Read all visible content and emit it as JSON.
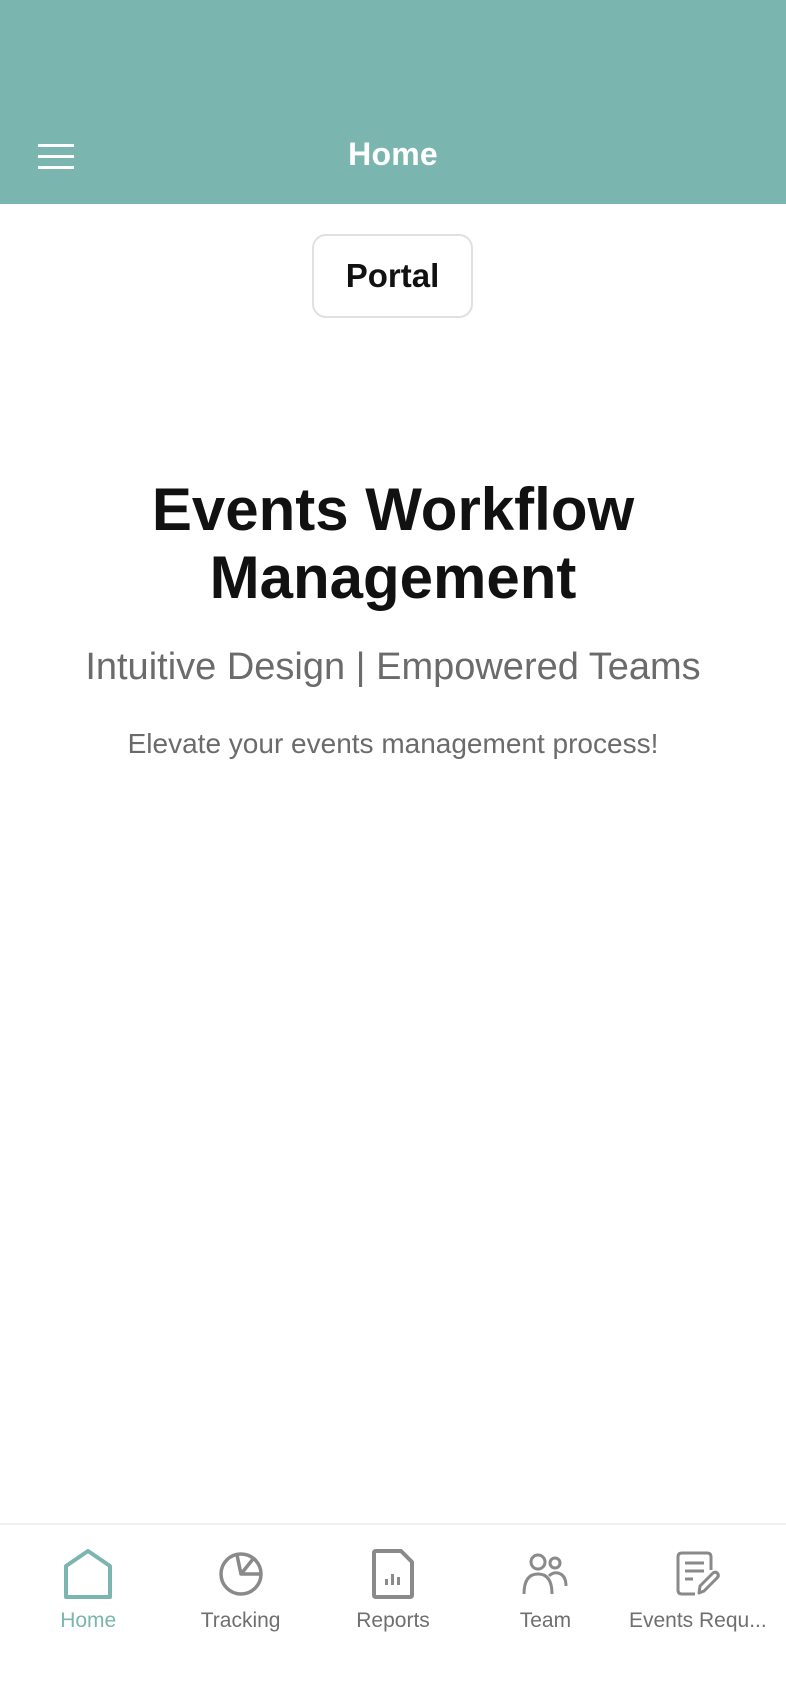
{
  "header": {
    "title": "Home",
    "menu_icon": "hamburger-menu-icon",
    "background": "#7bb5af"
  },
  "portal_button": {
    "label": "Portal"
  },
  "hero": {
    "title": "Events Workflow Management",
    "subtitle": "Intuitive Design | Empowered Teams",
    "tagline": "Elevate your events management process!"
  },
  "tabbar": {
    "active_color": "#7bb5af",
    "inactive_color": "#8a8a8a",
    "tabs": [
      {
        "label": "Home",
        "icon": "home-icon",
        "active": true
      },
      {
        "label": "Tracking",
        "icon": "pie-chart-icon",
        "active": false
      },
      {
        "label": "Reports",
        "icon": "report-document-icon",
        "active": false
      },
      {
        "label": "Team",
        "icon": "people-icon",
        "active": false
      },
      {
        "label": "Events Requ...",
        "icon": "document-edit-icon",
        "active": false
      }
    ]
  }
}
